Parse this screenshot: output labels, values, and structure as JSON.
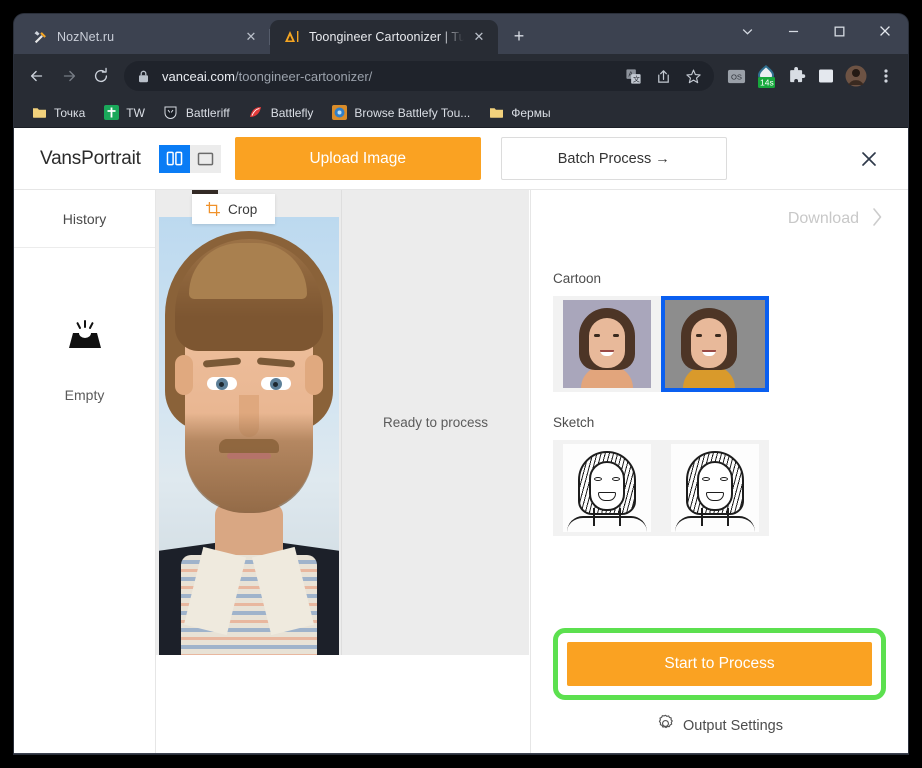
{
  "browser": {
    "tabs": [
      {
        "title": "NozNet.ru",
        "active": false,
        "favicon": "tools-icon",
        "close_label": "✕"
      },
      {
        "title": "Toongineer Cartoonizer | Turn Ph",
        "active": true,
        "favicon": "vanceai-icon",
        "close_label": "✕"
      }
    ],
    "new_tab_label": "+",
    "window_controls": [
      "chevron-down",
      "minimize",
      "maximize",
      "close"
    ],
    "nav": {
      "back": "←",
      "forward": "→",
      "reload": "↻"
    },
    "omnibox": {
      "lock": "lock-icon",
      "url_domain": "vanceai.com",
      "url_path": "/toongineer-cartoonizer/",
      "icons": [
        "translate-icon",
        "share-icon",
        "bookmark-star-icon"
      ]
    },
    "extensions": [
      "os-extension-icon",
      "timer-14s-icon",
      "puzzle-extensions-icon",
      "side-panel-icon",
      "profile-avatar",
      "three-dot-menu"
    ],
    "timer_badge": "14s",
    "os_badge": "OS",
    "bookmarks": [
      {
        "label": "Точка",
        "icon": "folder-icon"
      },
      {
        "label": "TW",
        "icon": "tw-icon"
      },
      {
        "label": "Battleriff",
        "icon": "battleriff-icon"
      },
      {
        "label": "Battlefly",
        "icon": "battlefly-icon"
      },
      {
        "label": "Browse Battlefy Tou...",
        "icon": "battlefy-icon"
      },
      {
        "label": "Фермы",
        "icon": "folder-icon"
      }
    ]
  },
  "app": {
    "brand": "VansPortrait",
    "view_toggle": {
      "split_label": "split-view",
      "single_label": "single-view",
      "active": "split"
    },
    "upload_label": "Upload Image",
    "batch_label": "Batch Process →",
    "close_label": "✕"
  },
  "history": {
    "title": "History",
    "empty_label": "Empty",
    "empty_icon": "inbox-empty-icon"
  },
  "canvas": {
    "crop_label": "Crop",
    "crop_icon": "crop-icon",
    "status_label": "Ready to process"
  },
  "options": {
    "download_label": "Download",
    "download_chevron": "›",
    "sections": [
      {
        "title": "Cartoon",
        "items": [
          {
            "name": "cartoon-style-1",
            "selected": false
          },
          {
            "name": "cartoon-style-2",
            "selected": true
          }
        ]
      },
      {
        "title": "Sketch",
        "items": [
          {
            "name": "sketch-style-1",
            "selected": false
          },
          {
            "name": "sketch-style-2",
            "selected": false
          }
        ]
      }
    ],
    "start_label": "Start to Process",
    "output_settings_label": "Output Settings",
    "output_settings_icon": "gear-icon",
    "highlight_color": "#5ce04f",
    "accent_color": "#faa222",
    "selected_color": "#0a5ff0"
  }
}
